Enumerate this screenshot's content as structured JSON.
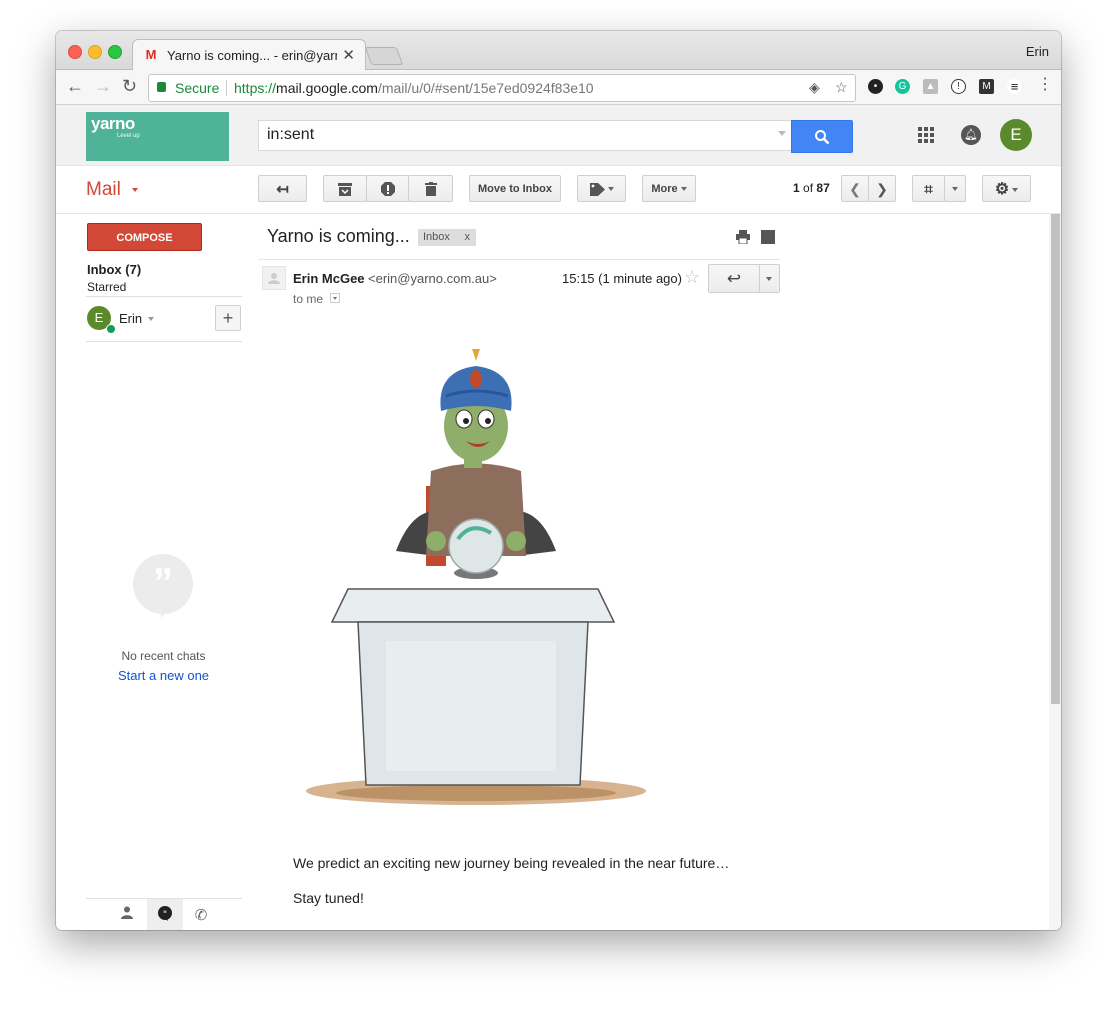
{
  "browser": {
    "tab_title": "Yarno is coming... - erin@yarno.com.au",
    "tab_close": "✕",
    "profile": "Erin",
    "secure_label": "Secure",
    "url_scheme": "https://",
    "url_host": "mail.google.com",
    "url_path": "/mail/u/0/#sent/15e7ed0924f83e10"
  },
  "gmail": {
    "logo_text": "yarno",
    "logo_sub": "Level up",
    "search_value": "in:sent",
    "avatar_initial": "E",
    "mail_label": "Mail",
    "move_to_inbox": "Move to Inbox",
    "more": "More",
    "pager_current": "1",
    "pager_of": "of",
    "pager_total": "87"
  },
  "sidebar": {
    "compose": "COMPOSE",
    "inbox": "Inbox (7)",
    "starred": "Starred",
    "chat_user": "Erin",
    "chat_user_initial": "E",
    "no_chats": "No recent chats",
    "start_new": "Start a new one"
  },
  "message": {
    "subject": "Yarno is coming...",
    "label": "Inbox",
    "label_remove": "x",
    "sender_name": "Erin McGee",
    "sender_email": "<erin@yarno.com.au>",
    "to": "to me",
    "time": "15:15 (1 minute ago)",
    "body_line1": "We predict an exciting new journey being revealed in the near future…",
    "body_line2": "Stay tuned!"
  },
  "colors": {
    "brand_teal": "#4fb399",
    "gmail_red": "#d14836",
    "search_blue": "#4285f4",
    "avatar_green": "#5b8a2c",
    "link_blue": "#1155cc"
  }
}
